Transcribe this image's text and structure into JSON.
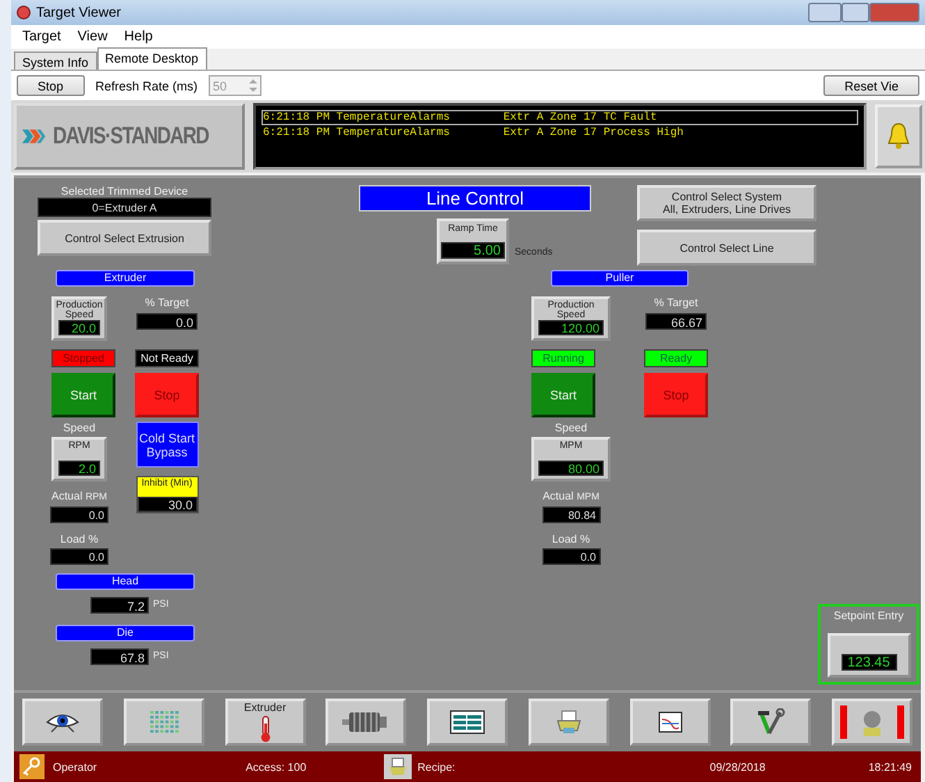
{
  "window": {
    "title": "Target Viewer"
  },
  "menu": [
    "Target",
    "View",
    "Help"
  ],
  "tabs": [
    {
      "label": "System Info",
      "selected": false
    },
    {
      "label": "Remote Desktop",
      "selected": true
    }
  ],
  "toolbar": {
    "stop_button": "Stop",
    "refresh_label": "Refresh Rate (ms)",
    "refresh_value": "50",
    "refresh_disabled": true,
    "reset_button": "Reset Vie"
  },
  "logo": {
    "text": "DAVIS·STANDARD"
  },
  "alarms": [
    {
      "time": "6:21:18 PM",
      "source": "TemperatureAlarms",
      "message": "Extr A Zone 17 TC Fault",
      "selected": true
    },
    {
      "time": "6:21:18 PM",
      "source": "TemperatureAlarms",
      "message": "Extr A Zone 17 Process High",
      "selected": false
    }
  ],
  "device": {
    "label": "Selected Trimmed Device",
    "value": "0=Extruder A",
    "button": "Control Select Extrusion"
  },
  "line_control": {
    "title": "Line Control",
    "ramp_label": "Ramp Time",
    "ramp_value": "5.00",
    "ramp_unit": "Seconds"
  },
  "system_buttons": [
    "Control Select System\nAll, Extruders, Line Drives",
    "Control Select Line"
  ],
  "sections": [
    {
      "kind": "extruder",
      "title": "Extruder",
      "speed_label": "Production Speed",
      "speed_value": "20.0",
      "target_label": "% Target",
      "target_value": "0.0",
      "state": "Stopped",
      "running": false,
      "ready_text": "Not Ready",
      "ready": false,
      "start": "Start",
      "stop": "Stop",
      "speed_heading": "Speed",
      "unit_label": "RPM",
      "unit_value": "2.0",
      "actual_label": "Actual",
      "actual_unit": "RPM",
      "actual_value": "0.0",
      "load_label": "Load %",
      "load_value": "0.0",
      "cold_start": "Cold Start Bypass",
      "inhibit_label": "Inhibit (Min)",
      "inhibit_value": "30.0",
      "pressures": [
        {
          "label": "Head",
          "value": "7.2",
          "unit": "PSI"
        },
        {
          "label": "Die",
          "value": "67.8",
          "unit": "PSI"
        }
      ]
    },
    {
      "kind": "puller",
      "title": "Puller",
      "speed_label": "Production Speed",
      "speed_value": "120.00",
      "target_label": "% Target",
      "target_value": "66.67",
      "state": "Running",
      "running": true,
      "ready_text": "Ready",
      "ready": true,
      "start": "Start",
      "stop": "Stop",
      "speed_heading": "Speed",
      "unit_label": "MPM",
      "unit_value": "80.00",
      "actual_label": "Actual",
      "actual_unit": "MPM",
      "actual_value": "80.84",
      "load_label": "Load %",
      "load_value": "0.0"
    }
  ],
  "setpoint": {
    "label": "Setpoint Entry",
    "value": "123.45"
  },
  "nav_buttons": [
    {
      "kind": "eye"
    },
    {
      "kind": "grid"
    },
    {
      "kind": "thermometer",
      "label": "Extruder"
    },
    {
      "kind": "motor"
    },
    {
      "kind": "table"
    },
    {
      "kind": "printer"
    },
    {
      "kind": "chart"
    },
    {
      "kind": "tools"
    },
    {
      "kind": "alarm"
    }
  ],
  "status_bar": {
    "user": "Operator",
    "access": "Access: 100",
    "recipe": "Recipe:",
    "date": "09/28/2018",
    "time": "18:21:49"
  }
}
